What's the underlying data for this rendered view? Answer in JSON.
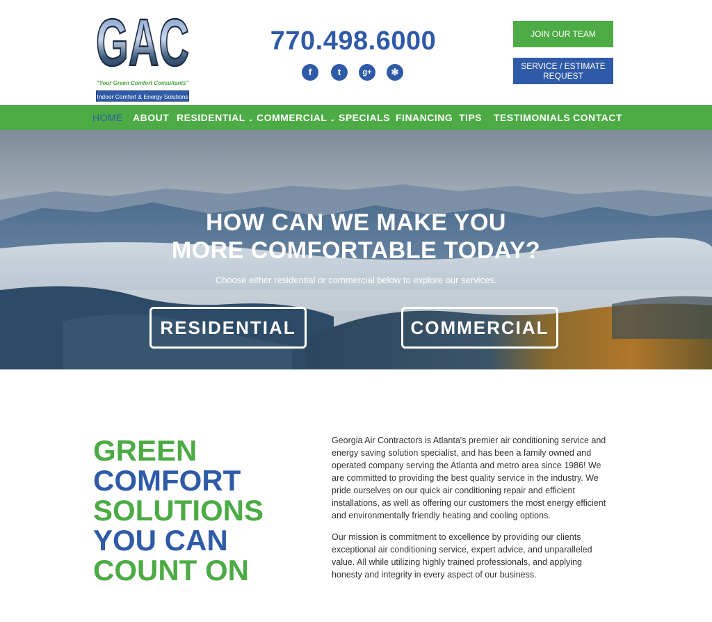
{
  "header": {
    "logo": {
      "letters": "GAC",
      "tagline": "\"Your Green Comfort Consultants\"",
      "subtitle": "Indoor Comfort & Energy Solutions"
    },
    "phone": "770.498.6000",
    "socials": [
      {
        "icon": "facebook-icon",
        "glyph": "f"
      },
      {
        "icon": "twitter-icon",
        "glyph": "t"
      },
      {
        "icon": "google-plus-icon",
        "glyph": "g+"
      },
      {
        "icon": "yelp-icon",
        "glyph": "✻"
      }
    ],
    "join_label": "JOIN OUR TEAM",
    "service_label": "SERVICE / ESTIMATE REQUEST"
  },
  "nav": {
    "items": [
      {
        "label": "HOME",
        "active": true
      },
      {
        "label": "ABOUT"
      },
      {
        "label": "RESIDENTIAL",
        "dropdown": true
      },
      {
        "label": "COMMERCIAL",
        "dropdown": true
      },
      {
        "label": "SPECIALS"
      },
      {
        "label": "FINANCING"
      },
      {
        "label": "TIPS"
      },
      {
        "label": "TESTIMONIALS"
      },
      {
        "label": "CONTACT"
      }
    ],
    "caret": "⌄"
  },
  "hero": {
    "title_line1": "HOW CAN WE MAKE YOU",
    "title_line2": "MORE COMFORTABLE TODAY?",
    "subtitle": "Choose either residential or commercial below to explore our services.",
    "residential_label": "RESIDENTIAL",
    "commercial_label": "COMMERCIAL"
  },
  "content": {
    "headline": [
      "GREEN",
      "COMFORT",
      "SOLUTIONS",
      "YOU CAN",
      "COUNT ON"
    ],
    "paragraph1": "Georgia Air Contractors is Atlanta's premier air conditioning service and energy saving solution specialist, and has been a family owned and operated company serving the Atlanta and metro area since 1986! We are committed to providing the best quality service in the industry. We pride ourselves on our quick air conditioning repair and efficient installations, as well as offering our customers the most energy efficient and environmentally friendly heating and cooling options.",
    "paragraph2": "Our mission is commitment to excellence by providing our clients exceptional air conditioning service, expert advice, and unparalleled value. All while utilizing highly trained professionals, and applying honesty and integrity in every aspect of our business."
  },
  "colors": {
    "green": "#4cab44",
    "blue": "#2f5aa8",
    "white": "#ffffff"
  }
}
